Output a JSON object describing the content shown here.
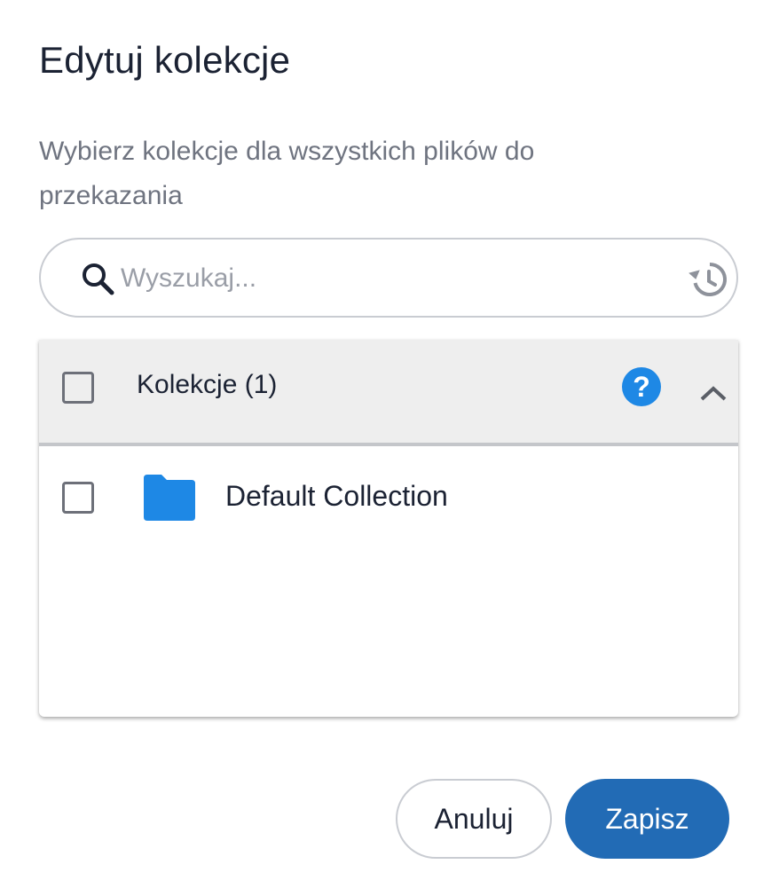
{
  "dialog": {
    "title": "Edytuj kolekcje",
    "subtitle": "Wybierz kolekcje dla wszystkich plików do przekazania"
  },
  "search": {
    "placeholder": "Wyszukaj...",
    "value": "",
    "icon": "search-icon",
    "history_icon": "history-icon"
  },
  "collections": {
    "header_label": "Kolekcje (1)",
    "header_checked": false,
    "help_icon": "help-icon",
    "expand_icon": "chevron-up-icon",
    "items": [
      {
        "label": "Default Collection",
        "checked": false,
        "icon": "folder-icon"
      }
    ]
  },
  "actions": {
    "cancel_label": "Anuluj",
    "save_label": "Zapisz"
  },
  "colors": {
    "primary": "#226bb5",
    "folder": "#1e88e5",
    "help": "#1e88e5",
    "header_bg": "#eeeeee"
  }
}
